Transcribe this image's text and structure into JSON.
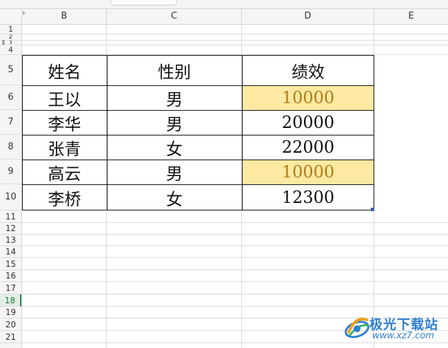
{
  "columns": [
    "B",
    "C",
    "D",
    "E"
  ],
  "rows": [
    "1",
    "2",
    "3",
    "4",
    "5",
    "6",
    "7",
    "8",
    "9",
    "10",
    "11",
    "12",
    "13",
    "14",
    "15",
    "16",
    "17",
    "18",
    "19",
    "20",
    "21"
  ],
  "active_row": "18",
  "table": {
    "headers": [
      "姓名",
      "性别",
      "绩效"
    ],
    "rows": [
      {
        "name": "王以",
        "gender": "男",
        "score": "10000",
        "highlight": true
      },
      {
        "name": "李华",
        "gender": "男",
        "score": "20000",
        "highlight": false
      },
      {
        "name": "张青",
        "gender": "女",
        "score": "22000",
        "highlight": false
      },
      {
        "name": "高云",
        "gender": "男",
        "score": "10000",
        "highlight": true
      },
      {
        "name": "李桥",
        "gender": "女",
        "score": "12300",
        "highlight": false
      }
    ]
  },
  "colors": {
    "highlight_fill": "#fde9a1",
    "highlight_text": "#b07c1c",
    "active_row_accent": "#217346",
    "watermark_blue": "#2f7fd0"
  },
  "watermark": {
    "title": "极光下载站",
    "url": "www.xz7.com",
    "icon": "aurora-logo-icon"
  },
  "icons": {
    "split": "row-split-icon",
    "select_all": "select-all-triangle-icon"
  }
}
